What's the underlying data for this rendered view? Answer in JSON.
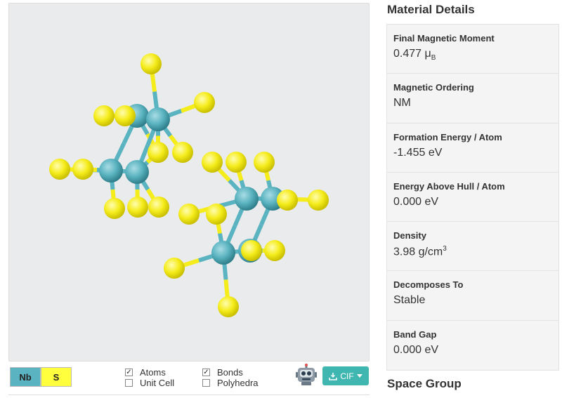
{
  "legend": [
    {
      "symbol": "Nb",
      "color": "#5ab3c0"
    },
    {
      "symbol": "S",
      "color": "#ffff3d"
    }
  ],
  "options": {
    "atoms": {
      "label": "Atoms",
      "checked": true
    },
    "bonds": {
      "label": "Bonds",
      "checked": true
    },
    "unit_cell": {
      "label": "Unit Cell",
      "checked": false
    },
    "polyhedra": {
      "label": "Polyhedra",
      "checked": false
    }
  },
  "cif_button": {
    "label": "CIF"
  },
  "panel": {
    "title": "Material Details",
    "next_section": "Space Group",
    "properties": [
      {
        "label": "Final Magnetic Moment",
        "value": "0.477 μ",
        "sub": "B",
        "sup": ""
      },
      {
        "label": "Magnetic Ordering",
        "value": "NM",
        "sub": "",
        "sup": ""
      },
      {
        "label": "Formation Energy / Atom",
        "value": "-1.455 eV",
        "sub": "",
        "sup": ""
      },
      {
        "label": "Energy Above Hull / Atom",
        "value": "0.000 eV",
        "sub": "",
        "sup": ""
      },
      {
        "label": "Density",
        "value": "3.98 g/cm",
        "sub": "",
        "sup": "3"
      },
      {
        "label": "Decomposes To",
        "value": "Stable",
        "sub": "",
        "sup": ""
      },
      {
        "label": "Band Gap",
        "value": "0.000 eV",
        "sub": "",
        "sup": ""
      }
    ]
  },
  "colors": {
    "nb_atom": "#5ab3c0",
    "s_atom": "#f5ec1c",
    "accent": "#3fb6b0"
  }
}
